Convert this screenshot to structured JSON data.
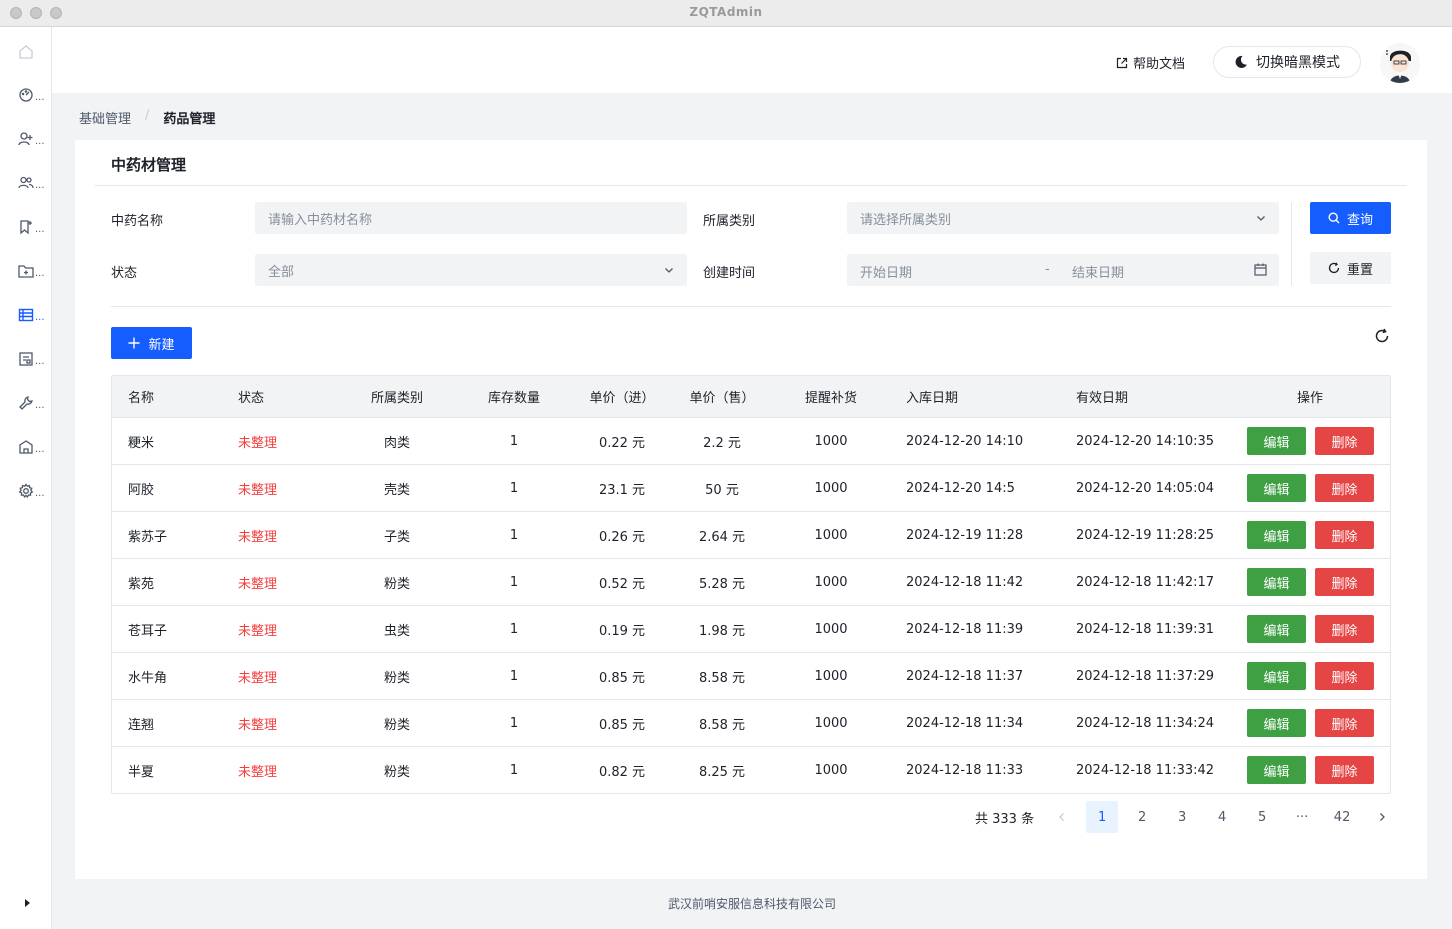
{
  "window": {
    "title": "ZQTAdmin"
  },
  "header": {
    "help_label": "帮助文档",
    "dark_mode_label": "切换暗黑模式"
  },
  "sidebar": {
    "items": [
      {
        "icon": "home-icon",
        "active": false
      },
      {
        "icon": "dashboard-icon",
        "active": false
      },
      {
        "icon": "user-add-icon",
        "active": false
      },
      {
        "icon": "user-group-icon",
        "active": false
      },
      {
        "icon": "bookmark-icon",
        "active": false
      },
      {
        "icon": "folder-add-icon",
        "active": false
      },
      {
        "icon": "table-icon",
        "active": true
      },
      {
        "icon": "file-icon",
        "active": false
      },
      {
        "icon": "tool-icon",
        "active": false
      },
      {
        "icon": "building-icon",
        "active": false
      },
      {
        "icon": "settings-icon",
        "active": false
      }
    ],
    "more": "..."
  },
  "breadcrumb": {
    "parent": "基础管理",
    "separator": "/",
    "current": "药品管理"
  },
  "card": {
    "title": "中药材管理"
  },
  "filters": {
    "name_label": "中药名称",
    "name_placeholder": "请输入中药材名称",
    "category_label": "所属类别",
    "category_placeholder": "请选择所属类别",
    "status_label": "状态",
    "status_value": "全部",
    "created_label": "创建时间",
    "start_placeholder": "开始日期",
    "range_sep": "-",
    "end_placeholder": "结束日期",
    "query_label": "查询",
    "reset_label": "重置"
  },
  "toolbar": {
    "new_label": "新建"
  },
  "table": {
    "columns": [
      "名称",
      "状态",
      "所属类别",
      "库存数量",
      "单价（进）",
      "单价（售）",
      "提醒补货",
      "入库日期",
      "有效日期",
      "操作"
    ],
    "edit_label": "编辑",
    "delete_label": "删除",
    "rows": [
      [
        "粳米",
        "未整理",
        "肉类",
        "1",
        "0.22 元",
        "2.2 元",
        "1000",
        "2024-12-20 14:10",
        "2024-12-20 14:10:35"
      ],
      [
        "阿胶",
        "未整理",
        "壳类",
        "1",
        "23.1 元",
        "50 元",
        "1000",
        "2024-12-20 14:5",
        "2024-12-20 14:05:04"
      ],
      [
        "紫苏子",
        "未整理",
        "子类",
        "1",
        "0.26 元",
        "2.64 元",
        "1000",
        "2024-12-19 11:28",
        "2024-12-19 11:28:25"
      ],
      [
        "紫苑",
        "未整理",
        "粉类",
        "1",
        "0.52 元",
        "5.28 元",
        "1000",
        "2024-12-18 11:42",
        "2024-12-18 11:42:17"
      ],
      [
        "苍耳子",
        "未整理",
        "虫类",
        "1",
        "0.19 元",
        "1.98 元",
        "1000",
        "2024-12-18 11:39",
        "2024-12-18 11:39:31"
      ],
      [
        "水牛角",
        "未整理",
        "粉类",
        "1",
        "0.85 元",
        "8.58 元",
        "1000",
        "2024-12-18 11:37",
        "2024-12-18 11:37:29"
      ],
      [
        "连翘",
        "未整理",
        "粉类",
        "1",
        "0.85 元",
        "8.58 元",
        "1000",
        "2024-12-18 11:34",
        "2024-12-18 11:34:24"
      ],
      [
        "半夏",
        "未整理",
        "粉类",
        "1",
        "0.82 元",
        "8.25 元",
        "1000",
        "2024-12-18 11:33",
        "2024-12-18 11:33:42"
      ]
    ]
  },
  "pagination": {
    "total_text": "共 333 条",
    "pages": [
      "1",
      "2",
      "3",
      "4",
      "5",
      "···",
      "42"
    ],
    "current": "1"
  },
  "footer": {
    "text": "武汉前哨安服信息科技有限公司"
  },
  "colors": {
    "primary": "#165dff",
    "edit": "#3ea043",
    "delete": "#e54545",
    "status_red": "#f53f3f"
  }
}
